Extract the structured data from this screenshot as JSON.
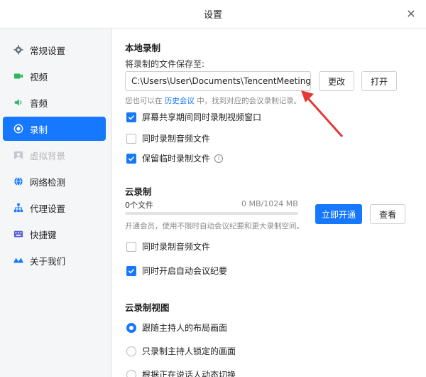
{
  "window": {
    "title": "设置"
  },
  "sidebar": {
    "items": [
      {
        "label": "常规设置",
        "icon": "gear-icon"
      },
      {
        "label": "视频",
        "icon": "video-icon"
      },
      {
        "label": "音频",
        "icon": "speaker-icon"
      },
      {
        "label": "录制",
        "icon": "record-icon",
        "active": true
      },
      {
        "label": "虚拟背景",
        "icon": "image-icon",
        "disabled": true
      },
      {
        "label": "网络检测",
        "icon": "globe-icon"
      },
      {
        "label": "代理设置",
        "icon": "network-icon"
      },
      {
        "label": "快捷键",
        "icon": "keyboard-icon"
      },
      {
        "label": "关于我们",
        "icon": "logo-icon"
      }
    ]
  },
  "local": {
    "title": "本地录制",
    "save_label": "将录制的文件保存至:",
    "path_value": "C:\\Users\\User\\Documents\\TencentMeeting",
    "change_button": "更改",
    "open_button": "打开",
    "hint_pre": "您也可以在",
    "hint_link": "历史会议",
    "hint_post": "中，找到对应的会议录制记录。",
    "options": [
      {
        "label": "屏幕共享期间同时录制视频窗口",
        "checked": true
      },
      {
        "label": "同时录制音频文件",
        "checked": false
      },
      {
        "label": "保留临时录制文件",
        "checked": true
      }
    ]
  },
  "cloud": {
    "title": "云录制",
    "files": "0个文件",
    "usage": "0 MB/1024 MB",
    "usage_fraction": 0,
    "activate_button": "立即开通",
    "view_button": "查看",
    "hint": "开通会员，使用不限时自动会议纪要和更大录制空间。",
    "options": [
      {
        "label": "同时录制音频文件",
        "checked": false
      },
      {
        "label": "同时开启自动会议纪要",
        "checked": true
      }
    ]
  },
  "cloud_view": {
    "title": "云录制视图",
    "options": [
      {
        "label": "跟随主持人的布局画面",
        "selected": true
      },
      {
        "label": "只录制主持人锁定的画面",
        "selected": false
      },
      {
        "label": "根据正在说话人动态切换",
        "selected": false
      }
    ]
  },
  "colors": {
    "accent": "#1677ff",
    "arrow": "#e53935"
  }
}
